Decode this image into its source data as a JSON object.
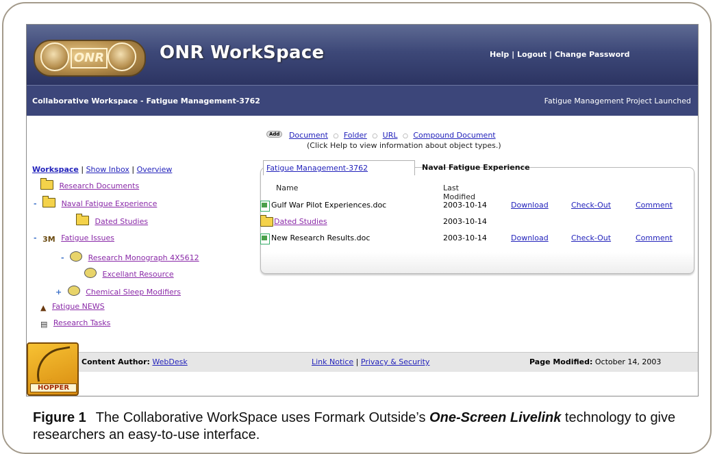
{
  "app": {
    "title": "ONR WorkSpace",
    "logo_text": "ONR",
    "top_links": [
      "Help",
      "Logout",
      "Change Password"
    ]
  },
  "subbar": {
    "workspace_title": "Collaborative Workspace - Fatigue Management-3762",
    "status": "Fatigue Management Project Launched"
  },
  "add": {
    "badge": "Add",
    "links": [
      "Document",
      "Folder",
      "URL",
      "Compound Document"
    ],
    "hint": "(Click Help to view information about object types.)"
  },
  "nav": {
    "tabs": [
      "Workspace",
      "Show Inbox",
      "Overview"
    ],
    "tree": [
      {
        "label": "Research Documents"
      },
      {
        "label": "Naval Fatigue Experience"
      },
      {
        "label": "Dated Studies"
      },
      {
        "label": "Fatigue Issues"
      },
      {
        "label": "Research Monograph 4X5612"
      },
      {
        "label": "Excellant Resource"
      },
      {
        "label": "Chemical Sleep Modifiers"
      },
      {
        "label": "Fatigue NEWS"
      },
      {
        "label": "Research Tasks"
      }
    ]
  },
  "breadcrumb": [
    "Fatigue Management-3762",
    "Naval Fatigue Experience"
  ],
  "table": {
    "headers": [
      "Name",
      "Last Modified"
    ],
    "rows": [
      {
        "name": "Gulf War Pilot Experiences.doc",
        "date": "2003-10-14",
        "actions": [
          "Download",
          "Check-Out",
          "Comment"
        ]
      },
      {
        "name": "Dated Studies",
        "date": "2003-10-14",
        "actions": []
      },
      {
        "name": "New Research Results.doc",
        "date": "2003-10-14",
        "actions": [
          "Download",
          "Check-Out",
          "Comment"
        ]
      }
    ]
  },
  "footer": {
    "author_label": "Content Author:",
    "author": "WebDesk",
    "link_notice": "Link Notice",
    "privacy": "Privacy & Security",
    "modified_label": "Page Modified:",
    "modified": "October 14, 2003",
    "hopper": "HOPPER"
  },
  "caption": {
    "figure": "Figure 1",
    "text1": "The Collaborative WorkSpace uses Formark Outside’s",
    "emphasis": "One-Screen Livelink",
    "text2": "technology to give researchers an easy-to-use interface."
  },
  "colors": {
    "banner": "#3d4878",
    "link": "#2222bb",
    "visited": "#8a2aa8",
    "footer": "#e6e6e6"
  }
}
